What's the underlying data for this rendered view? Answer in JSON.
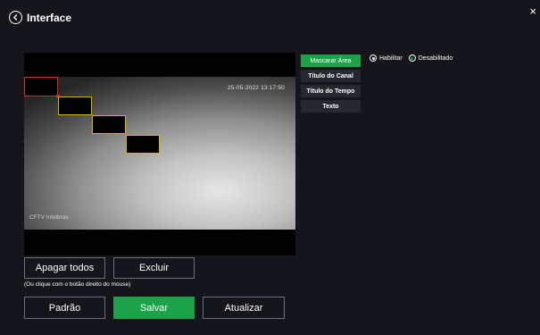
{
  "header": {
    "title": "Interface"
  },
  "video": {
    "timestamp": "25-05-2022 13:17:50",
    "channel_label": "CFTV Intelbras"
  },
  "side_menu": [
    {
      "label": "Mascarar Área",
      "active": true
    },
    {
      "label": "Título do Canal",
      "active": false
    },
    {
      "label": "Título do Tempo",
      "active": false
    },
    {
      "label": "Texto",
      "active": false
    }
  ],
  "mask_mode": {
    "enable_label": "Habilitar",
    "disable_label": "Desabilitado",
    "selected": "Desabilitado"
  },
  "actions": {
    "clear_all": "Apagar todos",
    "delete": "Excluir",
    "hint": "(Ou clique com o botão direito do mouse)"
  },
  "footer": {
    "default": "Padrão",
    "save": "Salvar",
    "refresh": "Atualizar"
  },
  "colors": {
    "accent": "#1ca34a",
    "mask_border": "#d6b400",
    "mask_active_border": "#e02424"
  }
}
